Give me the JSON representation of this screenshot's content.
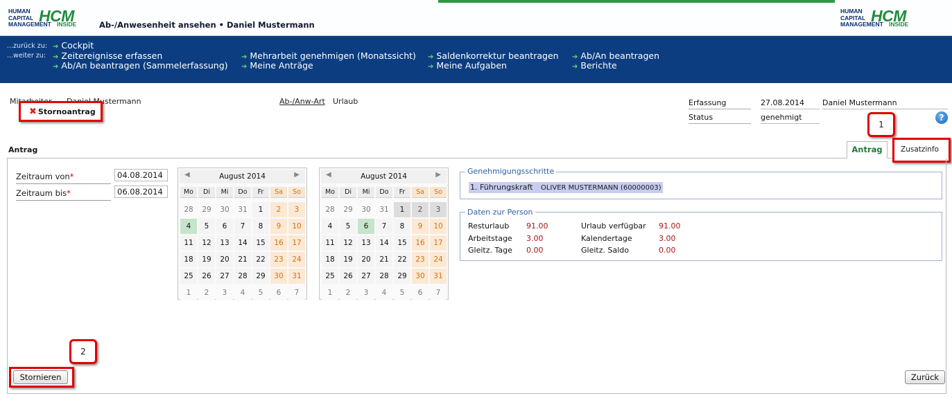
{
  "header": {
    "logo_text": "HUMAN\nCAPITAL\nMANAGEMENT",
    "logo_hcm": "HCM",
    "logo_inside": "INSIDE",
    "page_title": "Ab-/Anwesenheit ansehen • Daniel Mustermann"
  },
  "nav": {
    "back_label": "...zurück zu:",
    "forward_label": "...weiter zu:",
    "back_link": "Cockpit",
    "links": [
      "Zeitereignisse erfassen",
      "Ab/An beantragen (Sammelerfassung)",
      "Mehrarbeit genehmigen (Monatssicht)",
      "Meine Anträge",
      "Saldenkorrektur beantragen",
      "Meine Aufgaben",
      "Ab/An beantragen",
      "Berichte"
    ],
    "arrow_color": "#6dd36d"
  },
  "info": {
    "mitarbeiter_label": "Mitarbeiter",
    "mitarbeiter_value": "Daniel Mustermann",
    "storno_label": "Stornoantrag",
    "art_label": "Ab-/Anw-Art",
    "art_value": "Urlaub",
    "erfassung_label": "Erfassung",
    "erfassung_date": "27.08.2014",
    "erfassung_user": "Daniel Mustermann",
    "status_label": "Status",
    "status_value": "genehmigt"
  },
  "callouts": {
    "one": "1",
    "two": "2"
  },
  "section": {
    "heading": "Antrag",
    "tab_antrag": "Antrag",
    "tab_zusatz": "Zusatzinfo"
  },
  "form": {
    "von_label": "Zeitraum von",
    "bis_label": "Zeitraum bis",
    "required_mark": "*",
    "von_value": "04.08.2014",
    "bis_value": "06.08.2014"
  },
  "calendars": [
    {
      "title": "August 2014",
      "weekdays": [
        "Mo",
        "Di",
        "Mi",
        "Do",
        "Fr",
        "Sa",
        "So"
      ],
      "weeks": [
        [
          "28",
          "29",
          "30",
          "31",
          "1",
          "2",
          "3"
        ],
        [
          "4",
          "5",
          "6",
          "7",
          "8",
          "9",
          "10"
        ],
        [
          "11",
          "12",
          "13",
          "14",
          "15",
          "16",
          "17"
        ],
        [
          "18",
          "19",
          "20",
          "21",
          "22",
          "23",
          "24"
        ],
        [
          "25",
          "26",
          "27",
          "28",
          "29",
          "30",
          "31"
        ],
        [
          "1",
          "2",
          "3",
          "4",
          "5",
          "6",
          "7"
        ]
      ],
      "highlight_day": "4"
    },
    {
      "title": "August 2014",
      "weekdays": [
        "Mo",
        "Di",
        "Mi",
        "Do",
        "Fr",
        "Sa",
        "So"
      ],
      "weeks": [
        [
          "28",
          "29",
          "30",
          "31",
          "1",
          "2",
          "3"
        ],
        [
          "4",
          "5",
          "6",
          "7",
          "8",
          "9",
          "10"
        ],
        [
          "11",
          "12",
          "13",
          "14",
          "15",
          "16",
          "17"
        ],
        [
          "18",
          "19",
          "20",
          "21",
          "22",
          "23",
          "24"
        ],
        [
          "25",
          "26",
          "27",
          "28",
          "29",
          "30",
          "31"
        ],
        [
          "1",
          "2",
          "3",
          "4",
          "5",
          "6",
          "7"
        ]
      ],
      "highlight_day": "6"
    }
  ],
  "genehmigung": {
    "legend": "Genehmigungsschritte",
    "step": "1. Führungskraft",
    "approver": "OLIVER MUSTERMANN (60000003)"
  },
  "person": {
    "legend": "Daten zur Person",
    "rows": [
      {
        "label": "Resturlaub",
        "value": "91.00",
        "label2": "Urlaub verfügbar",
        "value2": "91.00"
      },
      {
        "label": "Arbeitstage",
        "value": "3.00",
        "label2": "Kalendertage",
        "value2": "3.00"
      },
      {
        "label": "Gleitz. Tage",
        "value": "0.00",
        "label2": "Gleitz. Saldo",
        "value2": "0.00"
      }
    ]
  },
  "buttons": {
    "stornieren": "Stornieren",
    "zurueck": "Zurück"
  },
  "colors": {
    "nav_bg": "#0c3d80",
    "brand_green": "#1f8c3c",
    "callout_red": "#e00000",
    "value_red": "#a01818"
  }
}
